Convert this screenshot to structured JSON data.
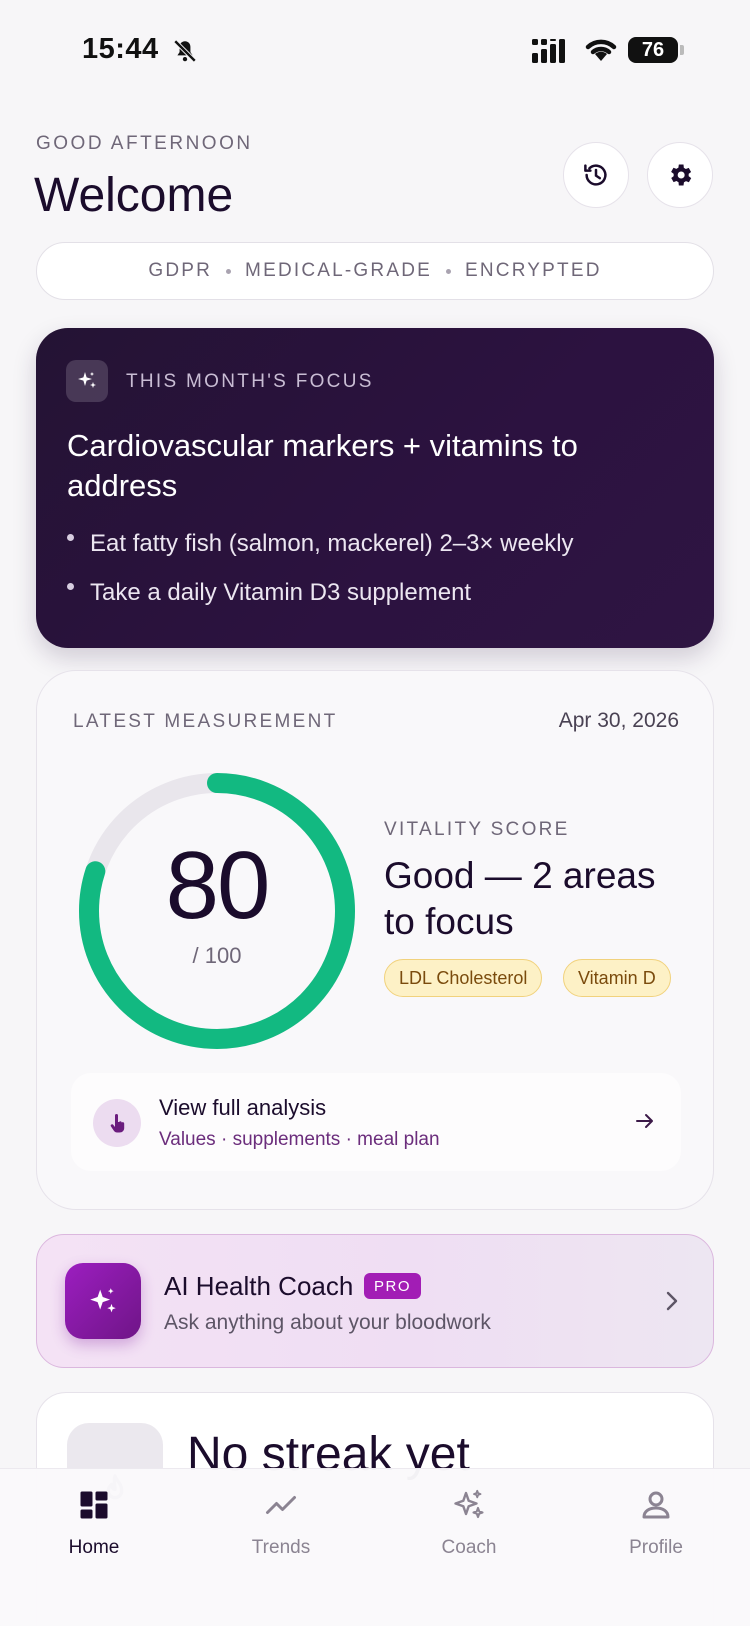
{
  "status_bar": {
    "time": "15:44",
    "battery": "76"
  },
  "header": {
    "greeting": "GOOD AFTERNOON",
    "title": "Welcome",
    "history_icon": "history-icon",
    "settings_icon": "gear-icon"
  },
  "trust": {
    "items": [
      "GDPR",
      "MEDICAL-GRADE",
      "ENCRYPTED"
    ]
  },
  "focus": {
    "kicker": "THIS MONTH'S FOCUS",
    "title": "Cardiovascular markers + vitamins to address",
    "bullets": [
      "Eat fatty fish (salmon, mackerel) 2–3× weekly",
      "Take a daily Vitamin D3 supplement"
    ]
  },
  "measurement": {
    "kicker": "LATEST MEASUREMENT",
    "date": "Apr 30, 2026",
    "score": "80",
    "score_max": "/ 100",
    "score_fraction": 0.8,
    "vitality_kicker": "VITALITY SCORE",
    "vitality_text": "Good — 2 areas to focus",
    "chips": [
      "LDL Cholesterol",
      "Vitamin D"
    ],
    "analysis_title": "View full analysis",
    "analysis_sub": "Values · supplements · meal plan",
    "ring_color": "#12b981"
  },
  "coach": {
    "title": "AI Health Coach",
    "badge": "PRO",
    "subtitle": "Ask anything about your bloodwork"
  },
  "streak": {
    "title": "No streak yet"
  },
  "nav": {
    "home": "Home",
    "trends": "Trends",
    "coach": "Coach",
    "profile": "Profile"
  }
}
